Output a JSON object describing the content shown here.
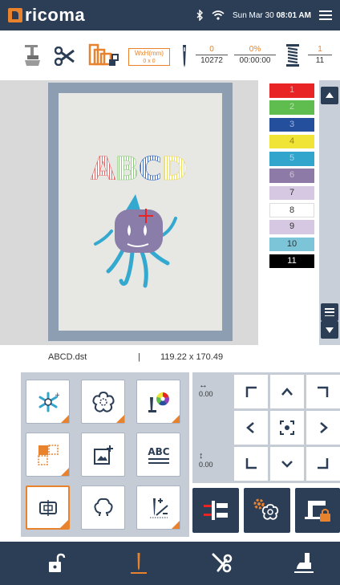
{
  "app": {
    "brand": "ricoma"
  },
  "status_bar": {
    "date": "Sun Mar 30",
    "time": "08:01 AM"
  },
  "toolbar": {
    "size_label": "WxH(mm)",
    "size_value": "0 x 0",
    "stitch_current": "0",
    "stitch_total": "10272",
    "progress_percent": "0%",
    "progress_time": "00:00:00",
    "color_current": "1",
    "color_total": "11",
    "accent": "#e9822c"
  },
  "colors": [
    {
      "label": "1",
      "hex": "#e82424",
      "text": "#e8a7a7"
    },
    {
      "label": "2",
      "hex": "#5fbd4f",
      "text": "#b8e0ae"
    },
    {
      "label": "3",
      "hex": "#234f9c",
      "text": "#9fb4dc"
    },
    {
      "label": "4",
      "hex": "#f0e436",
      "text": "#938722"
    },
    {
      "label": "5",
      "hex": "#32a5cd",
      "text": "#a1d7ea"
    },
    {
      "label": "6",
      "hex": "#8e7aa6",
      "text": "#cdc2d9"
    },
    {
      "label": "7",
      "hex": "#d6c8e2",
      "text": "#333333"
    },
    {
      "label": "8",
      "hex": "#ffffff",
      "text": "#333333"
    },
    {
      "label": "9",
      "hex": "#d6c8e2",
      "text": "#333333"
    },
    {
      "label": "10",
      "hex": "#7cc5d8",
      "text": "#333333"
    },
    {
      "label": "11",
      "hex": "#000000",
      "text": "#ffffff"
    }
  ],
  "design": {
    "text": "ABCD"
  },
  "file_info": {
    "filename": "ABCD.dst",
    "separator": "|",
    "dimensions": "119.22 x 170.49"
  },
  "offset": {
    "x": "0.00",
    "y": "0.00"
  },
  "icons": {
    "grid": [
      "snowflake-color-icon",
      "flower-outline-icon",
      "color-wheel-icon",
      "layout-blocks-icon",
      "add-image-icon",
      "abc-text-icon",
      "frame-select-icon",
      "cloud-outline-icon",
      "needle-plus-minus-icon"
    ],
    "actions": [
      "trace-icon",
      "gear-flower-icon",
      "machine-lock-icon"
    ],
    "nav": [
      "unlock-icon",
      "needle-icon",
      "scissors-icon",
      "presser-foot-icon"
    ]
  }
}
